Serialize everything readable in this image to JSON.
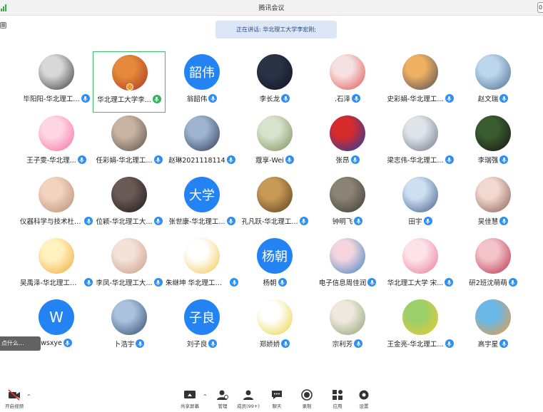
{
  "window": {
    "title": "腾讯会议"
  },
  "banner": {
    "speaking": "正在讲话: 华北理工大学李宏刚;"
  },
  "floating_hint": "点什么...",
  "participants": [
    {
      "name": "毕阳阳-华北理工...",
      "avatar": "photo",
      "colors": [
        "#d8d8d8",
        "#3a3a3a"
      ]
    },
    {
      "name": "华北理工大学李...",
      "avatar": "photo",
      "colors": [
        "#e58a3c",
        "#a8331f"
      ],
      "speaking": true
    },
    {
      "name": "翁韶伟",
      "avatar": "text",
      "avatar_text": "韶伟"
    },
    {
      "name": "李长龙",
      "avatar": "photo",
      "colors": [
        "#2a3346",
        "#0f1420"
      ]
    },
    {
      "name": ".石泽",
      "avatar": "photo",
      "colors": [
        "#f5e1e1",
        "#e0534f"
      ]
    },
    {
      "name": "史彩娟-华北理工...",
      "avatar": "photo",
      "colors": [
        "#f0b062",
        "#4b4a55"
      ]
    },
    {
      "name": "赵文瑞",
      "avatar": "photo",
      "colors": [
        "#bcd6ee",
        "#4d6c8e"
      ]
    },
    {
      "name": "王子雯-华北理...",
      "avatar": "photo",
      "colors": [
        "#ffd7e4",
        "#f26fa1"
      ]
    },
    {
      "name": "任彩娟-华北理工...",
      "avatar": "photo",
      "colors": [
        "#c9b4a3",
        "#5a5149"
      ]
    },
    {
      "name": "赵琳2021118114",
      "avatar": "photo",
      "colors": [
        "#9fb5cf",
        "#2d3b57"
      ]
    },
    {
      "name": "蔻享-Wei",
      "avatar": "photo",
      "colors": [
        "#d7e3cc",
        "#7b8f5a"
      ]
    },
    {
      "name": "张昂",
      "avatar": "photo",
      "colors": [
        "#d62b2b",
        "#1c3fa6"
      ]
    },
    {
      "name": "梁志伟-华北理工...",
      "avatar": "photo",
      "colors": [
        "#dfe3ea",
        "#6f7787"
      ]
    },
    {
      "name": "李瑞强",
      "avatar": "photo",
      "colors": [
        "#3a5c2e",
        "#141414"
      ]
    },
    {
      "name": "仪器科学与技术杜俊...",
      "avatar": "photo",
      "colors": [
        "#f2d3c0",
        "#b98b6f"
      ]
    },
    {
      "name": "位颖-华北理工大...",
      "avatar": "photo",
      "colors": [
        "#6a5a55",
        "#1d1816"
      ]
    },
    {
      "name": "张世康-华北理工...",
      "avatar": "text",
      "avatar_text": "大学"
    },
    {
      "name": "孔凡跃-华北理工...",
      "avatar": "photo",
      "colors": [
        "#c89a55",
        "#5a3f1f"
      ]
    },
    {
      "name": "钟明飞",
      "avatar": "photo",
      "colors": [
        "#8b8374",
        "#3b3a33"
      ]
    },
    {
      "name": "田宇",
      "avatar": "photo",
      "colors": [
        "#cfdff2",
        "#3e5b86"
      ]
    },
    {
      "name": "吴佳慧",
      "avatar": "photo",
      "colors": [
        "#f1d8d0",
        "#8a5c52"
      ]
    },
    {
      "name": "吴禹泽-华北理工大学",
      "avatar": "photo",
      "colors": [
        "#fff2c0",
        "#f2a93b"
      ]
    },
    {
      "name": "李凤-华北理工大...",
      "avatar": "photo",
      "colors": [
        "#f4e2d8",
        "#c99a86"
      ]
    },
    {
      "name": "朱继坤 华北理工大学",
      "avatar": "photo",
      "colors": [
        "#ffffff",
        "#f1c64b"
      ]
    },
    {
      "name": "杨朝",
      "avatar": "text",
      "avatar_text": "杨朝"
    },
    {
      "name": "电子信息周佳润",
      "avatar": "photo",
      "colors": [
        "#f5d4de",
        "#3d82c4"
      ]
    },
    {
      "name": "华北理工大学 宋...",
      "avatar": "photo",
      "colors": [
        "#fde3e9",
        "#e77a96"
      ]
    },
    {
      "name": "研2班沈萌萌",
      "avatar": "photo",
      "colors": [
        "#f3c3c9",
        "#b5324a"
      ]
    },
    {
      "name": "wsxye",
      "avatar": "text",
      "avatar_text": "W",
      "initial": true
    },
    {
      "name": "卜浩宇",
      "avatar": "photo",
      "colors": [
        "#a9c2de",
        "#2f4a6b"
      ]
    },
    {
      "name": "刘子良",
      "avatar": "text",
      "avatar_text": "子良"
    },
    {
      "name": "郑娇娇",
      "avatar": "photo",
      "colors": [
        "#ffffff",
        "#e7d23a"
      ]
    },
    {
      "name": "宗利芳",
      "avatar": "photo",
      "colors": [
        "#efe9dd",
        "#8da078"
      ]
    },
    {
      "name": "王金亮-华北理工...",
      "avatar": "photo",
      "colors": [
        "#9ad06a",
        "#f2c631"
      ]
    },
    {
      "name": "高宇星",
      "avatar": "photo",
      "colors": [
        "#69b8e8",
        "#ef9b3d"
      ]
    }
  ],
  "toolbar": {
    "mute_label": "开启视频",
    "share_label": "共享屏幕",
    "members_label": "管理",
    "participants_label": "成员(99+)",
    "chat_label": "聊天",
    "record_label": "录制",
    "apps_label": "应用",
    "settings_label": "设置"
  },
  "colors": {
    "accent": "#2483f2",
    "active_border": "#3cbf6b",
    "banner_bg": "#dbe7f7"
  }
}
